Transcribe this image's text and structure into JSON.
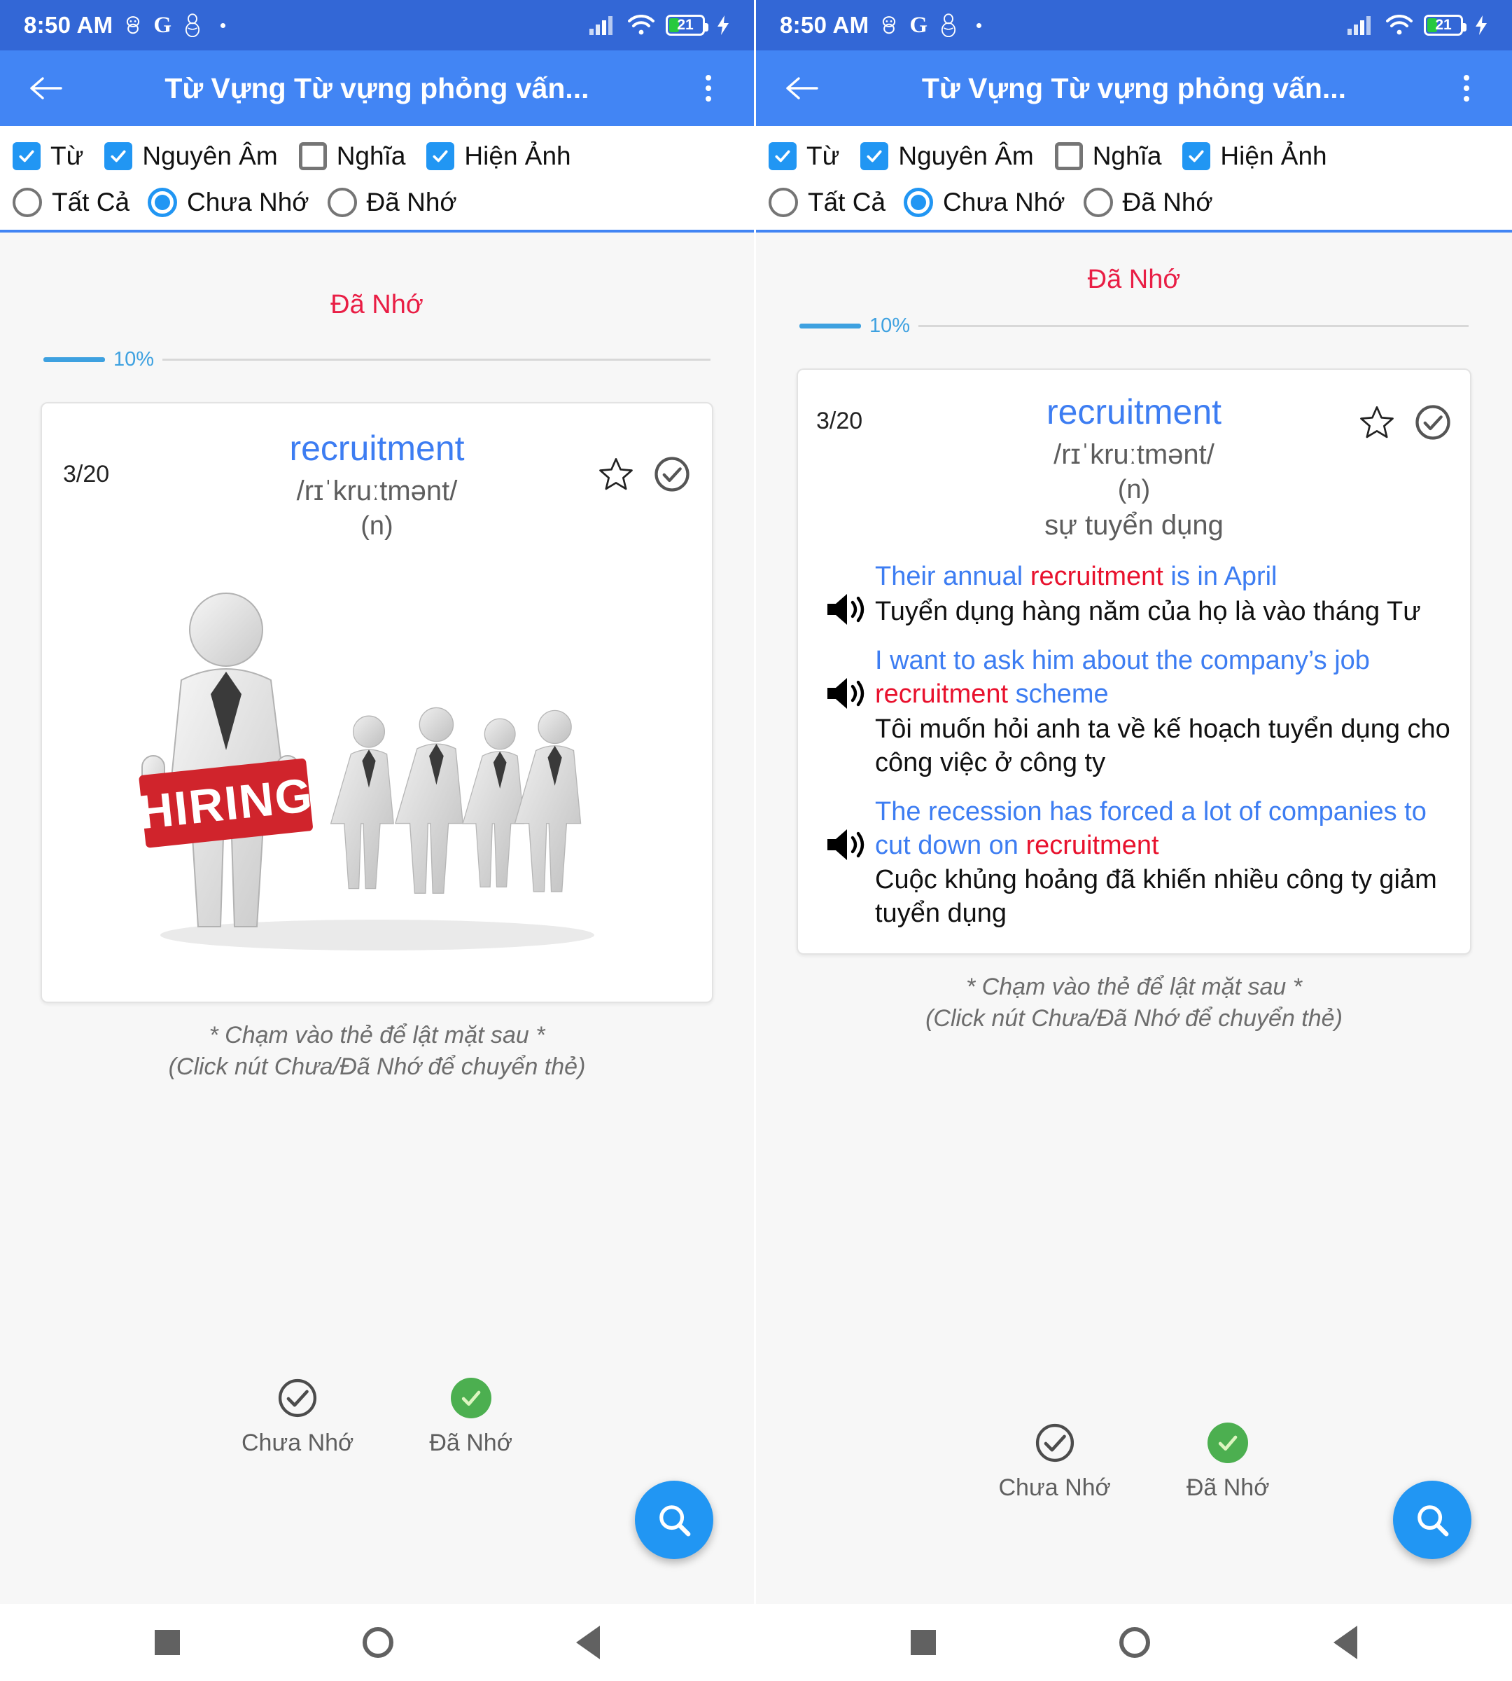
{
  "status_bar": {
    "time": "8:50 AM",
    "battery_percent": "21",
    "icons": [
      "android-robot-icon",
      "google-g-icon",
      "person-icon",
      "dot-icon",
      "signal-icon",
      "wifi-icon",
      "battery-icon",
      "charging-bolt-icon"
    ]
  },
  "app_bar": {
    "back_icon": "arrow-left-icon",
    "title": "Từ Vựng Từ vựng phỏng vấn...",
    "overflow_icon": "more-vertical-icon"
  },
  "filters": {
    "checkboxes": [
      {
        "label": "Từ",
        "checked": true
      },
      {
        "label": "Nguyên Âm",
        "checked": true
      },
      {
        "label": "Nghĩa",
        "checked": false
      },
      {
        "label": "Hiện Ảnh",
        "checked": true
      }
    ],
    "radios": [
      {
        "label": "Tất Cả",
        "selected": false
      },
      {
        "label": "Chưa Nhớ",
        "selected": true
      },
      {
        "label": "Đã Nhớ",
        "selected": false
      }
    ]
  },
  "progress": {
    "label": "Đã Nhớ",
    "percent_text": "10%",
    "percent_value": 10,
    "label_color": "#e91e45",
    "bar_color": "#3ea1e0"
  },
  "card": {
    "index": "3/20",
    "word": "recruitment",
    "phonetic": "/rɪˈkruːtmənt/",
    "part_of_speech": "(n)",
    "meaning": "sự tuyển dụng",
    "star_icon": "star-outline-icon",
    "check_icon": "check-circle-outline-icon",
    "image_alt": "hiring-illustration",
    "image_sign_text": "HIRING"
  },
  "examples": [
    {
      "speaker_icon": "volume-up-icon",
      "en_before": "Their annual ",
      "en_highlight": "recruitment",
      "en_after": " is in April",
      "vi": "Tuyển dụng hàng năm của họ là vào tháng Tư"
    },
    {
      "speaker_icon": "volume-up-icon",
      "en_before": "I want to ask him about the company’s job ",
      "en_highlight": "recruitment",
      "en_after": " scheme",
      "vi": "Tôi muốn hỏi anh ta về kế hoạch tuyển dụng cho công việc ở công ty"
    },
    {
      "speaker_icon": "volume-up-icon",
      "en_before": "The recession has forced a lot of companies to cut down on ",
      "en_highlight": "recruitment",
      "en_after": "",
      "vi": "Cuộc khủng hoảng đã khiến nhiều công ty giảm tuyển dụng"
    }
  ],
  "hints": {
    "line1": "* Chạm vào thẻ để lật mặt sau *",
    "line2": "(Click nút Chưa/Đã Nhớ để chuyển thẻ)"
  },
  "bottom_actions": [
    {
      "label": "Chưa Nhớ",
      "icon": "check-circle-outline-icon",
      "state": "inactive"
    },
    {
      "label": "Đã Nhớ",
      "icon": "check-circle-filled-icon",
      "state": "active",
      "color": "#4caf50"
    }
  ],
  "fab": {
    "icon": "search-icon",
    "color": "#2196f3"
  },
  "nav_bar": {
    "items": [
      {
        "icon": "square-recents-icon"
      },
      {
        "icon": "circle-home-icon"
      },
      {
        "icon": "triangle-back-icon"
      }
    ]
  }
}
